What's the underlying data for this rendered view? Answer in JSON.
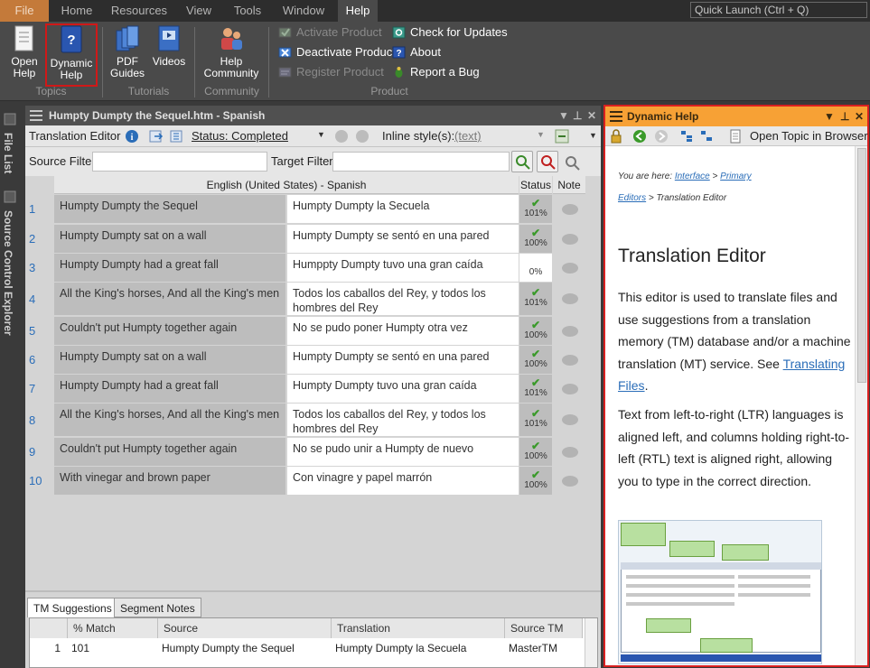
{
  "menubar": {
    "items": [
      "File",
      "Home",
      "Resources",
      "View",
      "Tools",
      "Window",
      "Help"
    ],
    "quick_launch_placeholder": "Quick Launch (Ctrl + Q)"
  },
  "ribbon": {
    "open_help": "Open Help",
    "dynamic_help": "Dynamic Help",
    "pdf_guides": "PDF Guides",
    "videos": "Videos",
    "help_community": "Help Community",
    "activate_product": "Activate Product",
    "deactivate_product": "Deactivate Product",
    "register_product": "Register Product",
    "check_updates": "Check for Updates",
    "about": "About",
    "report_bug": "Report a Bug",
    "groups": {
      "topics": "Topics",
      "tutorials": "Tutorials",
      "community": "Community",
      "product": "Product"
    }
  },
  "left_strip": {
    "file_list": "File List",
    "source_control": "Source Control Explorer"
  },
  "editor": {
    "title": "Humpty Dumpty the Sequel.htm - Spanish",
    "toolbar_label": "Translation Editor",
    "status": "Status: Completed",
    "inline_styles_label": "Inline style(s):",
    "inline_styles_value": "(text)",
    "source_filter": "Source Filter:",
    "target_filter": "Target Filter:",
    "grid_header": "English (United States) - Spanish",
    "status_header": "Status",
    "note_header": "Note",
    "rows": [
      {
        "num": "1",
        "src": "Humpty Dumpty the Sequel",
        "tgt": "Humpty Dumpty la Secuela",
        "pct": "101%",
        "check": true
      },
      {
        "num": "2",
        "src": "Humpty Dumpty sat on a wall",
        "tgt": "Humpty Dumpty se sentó en una pared",
        "pct": "100%",
        "check": true
      },
      {
        "num": "3",
        "src": "Humpty Dumpty had a great fall",
        "tgt": "Humppty Dumpty tuvo una gran caída",
        "pct": "0%",
        "check": false
      },
      {
        "num": "4",
        "src": "All the King's horses, And all the King's men",
        "tgt": "Todos los caballos del Rey, y todos los hombres del Rey",
        "pct": "101%",
        "check": true
      },
      {
        "num": "5",
        "src": "Couldn't put Humpty together again",
        "tgt": "No se pudo poner Humpty otra vez",
        "pct": "100%",
        "check": true
      },
      {
        "num": "6",
        "src": "Humpty Dumpty sat on a wall",
        "tgt": "Humpty Dumpty se sentó en una pared",
        "pct": "100%",
        "check": true
      },
      {
        "num": "7",
        "src": "Humpty Dumpty had a great fall",
        "tgt": "Humpty Dumpty tuvo una gran caída",
        "pct": "101%",
        "check": true
      },
      {
        "num": "8",
        "src": "All the King's horses, And all the King's men",
        "tgt": "Todos los caballos del Rey, y todos los hombres del Rey",
        "pct": "101%",
        "check": true
      },
      {
        "num": "9",
        "src": "Couldn't put Humpty together again",
        "tgt": "No se pudo unir a Humpty de nuevo",
        "pct": "100%",
        "check": true
      },
      {
        "num": "10",
        "src": "With vinegar and brown paper",
        "tgt": "Con vinagre y papel marrón",
        "pct": "100%",
        "check": true
      }
    ],
    "tabs": [
      "TM Suggestions",
      "Segment Notes"
    ],
    "tm_headers": [
      "% Match",
      "Source",
      "Translation",
      "Source TM"
    ],
    "tm_rows": [
      {
        "idx": "1",
        "match": "101",
        "source": "Humpty Dumpty the Sequel",
        "translation": "Humpty Dumpty la Secuela",
        "tm": "MasterTM"
      }
    ]
  },
  "help_panel": {
    "title": "Dynamic Help",
    "open_in_browser": "Open Topic in Browser",
    "you_are_here": "You are here:",
    "crumb_interface": "Interface",
    "crumb_primary": "Primary",
    "crumb_editors": "Editors",
    "crumb_current": "> Translation Editor",
    "heading": "Translation Editor",
    "p1_text": "This editor is used to translate files and use suggestions from a translation memory (TM) database and/or a machine translation (MT) service. See",
    "p1_link": "Translating Files",
    "p2": "Text from left-to-right (LTR) languages is aligned left, and columns holding right-to-left (RTL) text is aligned right, allowing you to type in the correct direction."
  },
  "colors": {
    "accent_orange": "#f7a135",
    "highlight_red": "#d92020",
    "status_green": "#3a9a2a"
  }
}
